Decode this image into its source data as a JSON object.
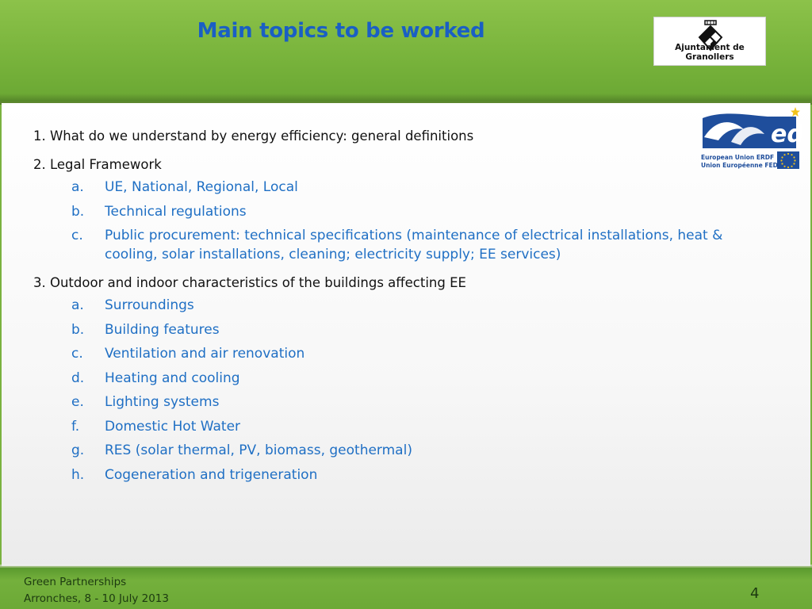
{
  "slide": {
    "title": "Main topics to be worked",
    "page_number": "4"
  },
  "logos": {
    "granollers": {
      "text": "Ajuntament de Granollers"
    },
    "med": {
      "word": "ed",
      "line1": "European Union ERDF",
      "line2": "Union Européenne FEDER"
    }
  },
  "topics": [
    {
      "title": "1. What do we understand by energy efficiency: general definitions",
      "items": []
    },
    {
      "title": "2. Legal Framework",
      "items": [
        {
          "marker": "a.",
          "text": "UE, National, Regional, Local"
        },
        {
          "marker": "b.",
          "text": "Technical regulations"
        },
        {
          "marker": "c.",
          "text": "Public procurement: technical specifications (maintenance of electrical installations, heat & cooling, solar installations, cleaning; electricity supply; EE services)"
        }
      ]
    },
    {
      "title": "3. Outdoor and indoor characteristics of the buildings affecting EE",
      "items": [
        {
          "marker": "a.",
          "text": "Surroundings"
        },
        {
          "marker": "b.",
          "text": "Building features"
        },
        {
          "marker": "c.",
          "text": "Ventilation and air renovation"
        },
        {
          "marker": "d.",
          "text": "Heating and cooling"
        },
        {
          "marker": "e.",
          "text": "Lighting systems"
        },
        {
          "marker": "f.",
          "text": "Domestic Hot Water"
        },
        {
          "marker": "g.",
          "text": "RES (solar thermal, PV, biomass, geothermal)"
        },
        {
          "marker": "h.",
          "text": "Cogeneration and trigeneration"
        }
      ]
    }
  ],
  "footer": {
    "line1": "Green Partnerships",
    "line2": "Arronches, 8 - 10 July 2013"
  },
  "colors": {
    "title": "#1a5fc4",
    "sub_item": "#1f6fc4",
    "header_green": "#79b43c",
    "med_blue": "#1f4e9c"
  }
}
